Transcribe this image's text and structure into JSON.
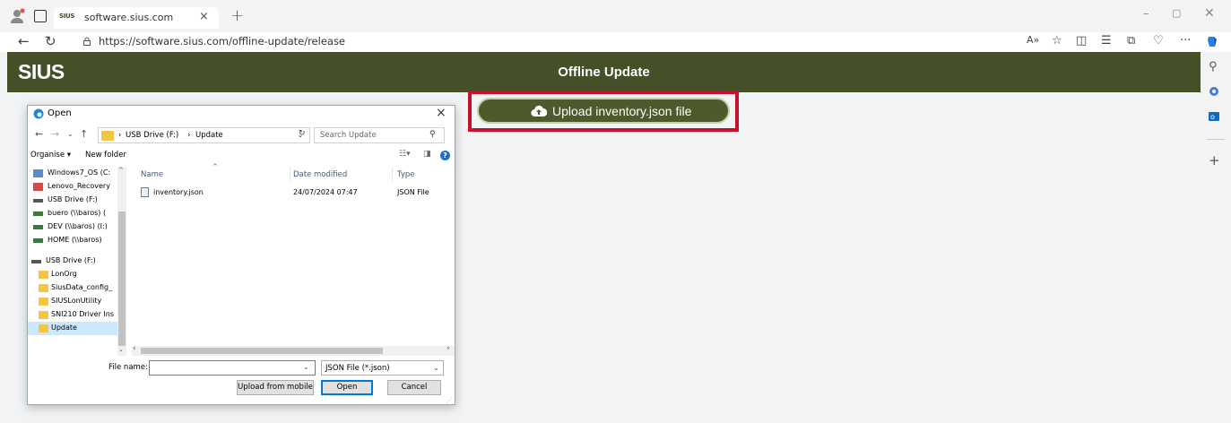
{
  "browser": {
    "tab": {
      "favicon_text": "SIUS",
      "title": "software.sius.com",
      "close": "×"
    },
    "new_tab": "+",
    "url": "https://software.sius.com/offline-update/release",
    "window_controls": {
      "minimize": "–",
      "maximize": "▢",
      "close": "✕"
    },
    "toolbar_icons": [
      "read-aloud-icon",
      "favorite-star-icon",
      "split-screen-icon",
      "favorites-icon",
      "collections-icon",
      "browser-essentials-icon",
      "more-icon",
      "copilot-icon"
    ],
    "more_label": "···",
    "sidebar_icons": [
      "search-icon",
      "shopping-icon",
      "outlook-icon",
      "add-icon"
    ]
  },
  "app": {
    "logo": "SIUS",
    "title": "Offline Update",
    "upload_button": {
      "label": "Upload inventory.json file",
      "icon": "cloud-upload-icon"
    },
    "highlight_color": "#c8102e",
    "header_color": "#454f28"
  },
  "dialog": {
    "title": "Open",
    "breadcrumb": [
      "USB Drive (F:)",
      "Update"
    ],
    "search_placeholder": "Search Update",
    "commands": {
      "organise": "Organise ▾",
      "new_folder": "New folder"
    },
    "nav_items": [
      {
        "label": "Windows7_OS (C:",
        "icon": "drive-icon"
      },
      {
        "label": "Lenovo_Recovery",
        "icon": "recovery-drive-icon"
      },
      {
        "label": "USB Drive (F:)",
        "icon": "usb-drive-icon"
      },
      {
        "label": "buero (\\\\baros) (",
        "icon": "network-drive-icon"
      },
      {
        "label": "DEV (\\\\baros) (I:)",
        "icon": "network-drive-icon"
      },
      {
        "label": "HOME (\\\\baros)",
        "icon": "network-drive-icon"
      },
      {
        "label": "USB Drive (F:)",
        "icon": "usb-drive-icon"
      },
      {
        "label": "LonOrg",
        "icon": "folder-icon"
      },
      {
        "label": "SiusData_config_",
        "icon": "folder-icon"
      },
      {
        "label": "SIUSLonUtility",
        "icon": "folder-icon"
      },
      {
        "label": "SNI210 Driver Ins",
        "icon": "folder-icon"
      },
      {
        "label": "Update",
        "icon": "folder-icon",
        "selected": true
      }
    ],
    "columns": {
      "name": "Name",
      "date": "Date modified",
      "type": "Type"
    },
    "files": [
      {
        "name": "inventory.json",
        "date": "24/07/2024 07:47",
        "type": "JSON File"
      }
    ],
    "file_name_label": "File name:",
    "file_name_value": "",
    "file_type": "JSON File (*.json)",
    "buttons": {
      "upload_mobile": "Upload from mobile",
      "open": "Open",
      "cancel": "Cancel"
    }
  }
}
